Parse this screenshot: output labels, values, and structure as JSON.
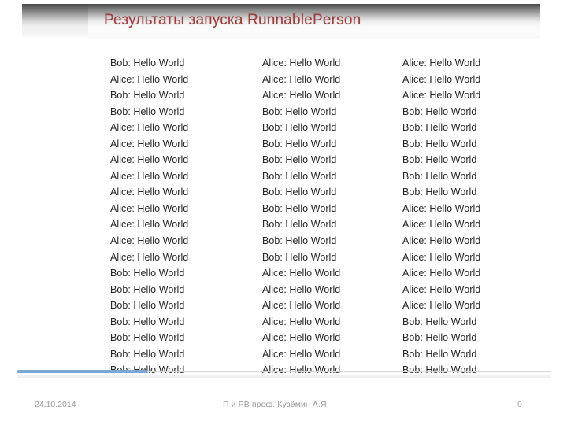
{
  "slide": {
    "title": "Результаты запуска RunnablePerson",
    "title_color": "#9e3c3c"
  },
  "console": {
    "columns": [
      {
        "lines": [
          "Bob: Hello World",
          "Alice: Hello World",
          "Bob: Hello World",
          "Bob: Hello World",
          "Alice: Hello World",
          "Alice: Hello World",
          "Alice: Hello World",
          "Alice: Hello World",
          "Alice: Hello World",
          "Alice: Hello World",
          "Alice: Hello World",
          "Alice: Hello World",
          "Alice: Hello World",
          "Bob: Hello World",
          "Bob: Hello World",
          "Bob: Hello World",
          "Bob: Hello World",
          "Bob: Hello World",
          "Bob: Hello World",
          "Bob: Hello World"
        ]
      },
      {
        "lines": [
          "Alice: Hello World",
          "Alice: Hello World",
          "Alice: Hello World",
          "Bob: Hello World",
          "Bob: Hello World",
          "Bob: Hello World",
          "Bob: Hello World",
          "Bob: Hello World",
          "Bob: Hello World",
          "Bob: Hello World",
          "Bob: Hello World",
          "Bob: Hello World",
          "Bob: Hello World",
          "Alice: Hello World",
          "Alice: Hello World",
          "Alice: Hello World",
          "Alice: Hello World",
          "Alice: Hello World",
          "Alice: Hello World",
          "Alice: Hello World"
        ]
      },
      {
        "lines": [
          "Alice: Hello World",
          "Alice: Hello World",
          "Alice: Hello World",
          "Bob: Hello World",
          "Bob: Hello World",
          "Bob: Hello World",
          "Bob: Hello World",
          "Bob: Hello World",
          "Bob: Hello World",
          "Alice: Hello World",
          "Alice: Hello World",
          "Alice: Hello World",
          "Alice: Hello World",
          "Alice: Hello World",
          "Alice: Hello World",
          "Alice: Hello World",
          "Bob: Hello World",
          "Bob: Hello World",
          "Bob: Hello World",
          "Bob: Hello World"
        ]
      }
    ]
  },
  "footer": {
    "date": "24.10.2014",
    "center": "П и РВ проф. Кузёмин А.Я.",
    "page": "9"
  }
}
